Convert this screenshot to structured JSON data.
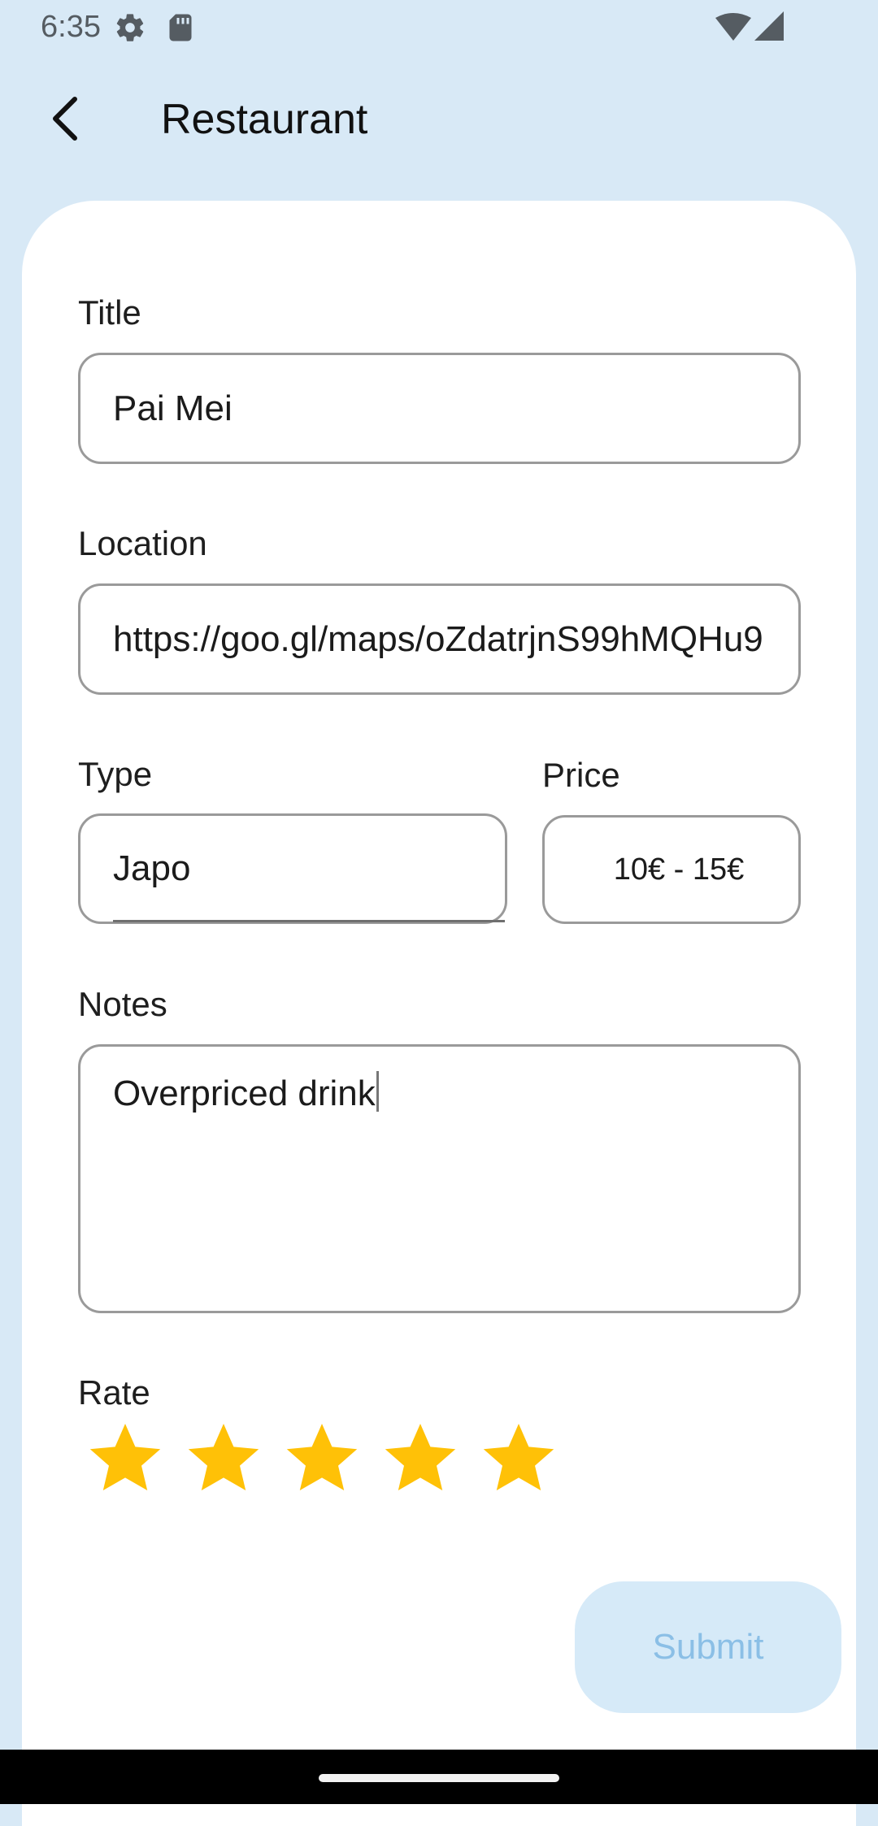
{
  "status_bar": {
    "time": "6:35",
    "icons": [
      "settings-gear-icon",
      "sd-card-icon",
      "wifi-icon",
      "cell-signal-icon"
    ]
  },
  "app_bar": {
    "title": "Restaurant",
    "back_icon": "chevron-left-icon"
  },
  "form": {
    "title_label": "Title",
    "title_value": "Pai Mei",
    "location_label": "Location",
    "location_value": "https://goo.gl/maps/oZdatrjnS99hMQHu9",
    "type_label": "Type",
    "type_value": "Japo",
    "price_label": "Price",
    "price_value": "10€ - 15€",
    "notes_label": "Notes",
    "notes_value": "Overpriced drink",
    "rate_label": "Rate",
    "rating": 5,
    "rating_max": 5,
    "submit_label": "Submit"
  },
  "colors": {
    "background": "#d8e9f6",
    "star": "#ffc107",
    "submit_bg": "#d6eaf8",
    "submit_text": "#8bbfe6"
  }
}
